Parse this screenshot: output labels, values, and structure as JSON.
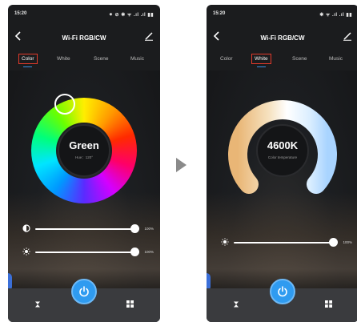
{
  "left_phone": {
    "status": {
      "time": "15:20",
      "icons": "⁕ ⊘ ✱ ᯤ .ıl .ıl ▮▮"
    },
    "title": "Wi-Fi RGB/CW",
    "tabs": [
      {
        "label": "Color",
        "active": true
      },
      {
        "label": "White",
        "active": false
      },
      {
        "label": "Scene",
        "active": false
      },
      {
        "label": "Music",
        "active": false
      }
    ],
    "color_name": "Green",
    "hue_label": "Hue：120°",
    "brightness_pct": "100%",
    "saturation_pct": "100%",
    "brightness_level": 1.0,
    "saturation_level": 1.0
  },
  "right_phone": {
    "status": {
      "time": "15:20",
      "icons": "✱ ᯤ .ıl .ıl ▮▮"
    },
    "title": "Wi-Fi RGB/CW",
    "tabs": [
      {
        "label": "Color",
        "active": false
      },
      {
        "label": "White",
        "active": true
      },
      {
        "label": "Scene",
        "active": false
      },
      {
        "label": "Music",
        "active": false
      }
    ],
    "temperature": "4600K",
    "temperature_label": "Color temperature",
    "brightness_pct": "100%",
    "brightness_level": 1.0
  },
  "colors": {
    "accent_blue": "#2f9bf0",
    "tab_highlight": "#e23a2b",
    "phone_bg": "#1b1c1e"
  },
  "icons": {
    "back": "chevron-left-icon",
    "edit": "pencil-icon",
    "brightness": "half-circle-icon",
    "saturation": "sun-icon",
    "timer": "hourglass-icon",
    "power": "power-icon",
    "grid": "grid-icon",
    "transition": "triangle-arrow"
  }
}
